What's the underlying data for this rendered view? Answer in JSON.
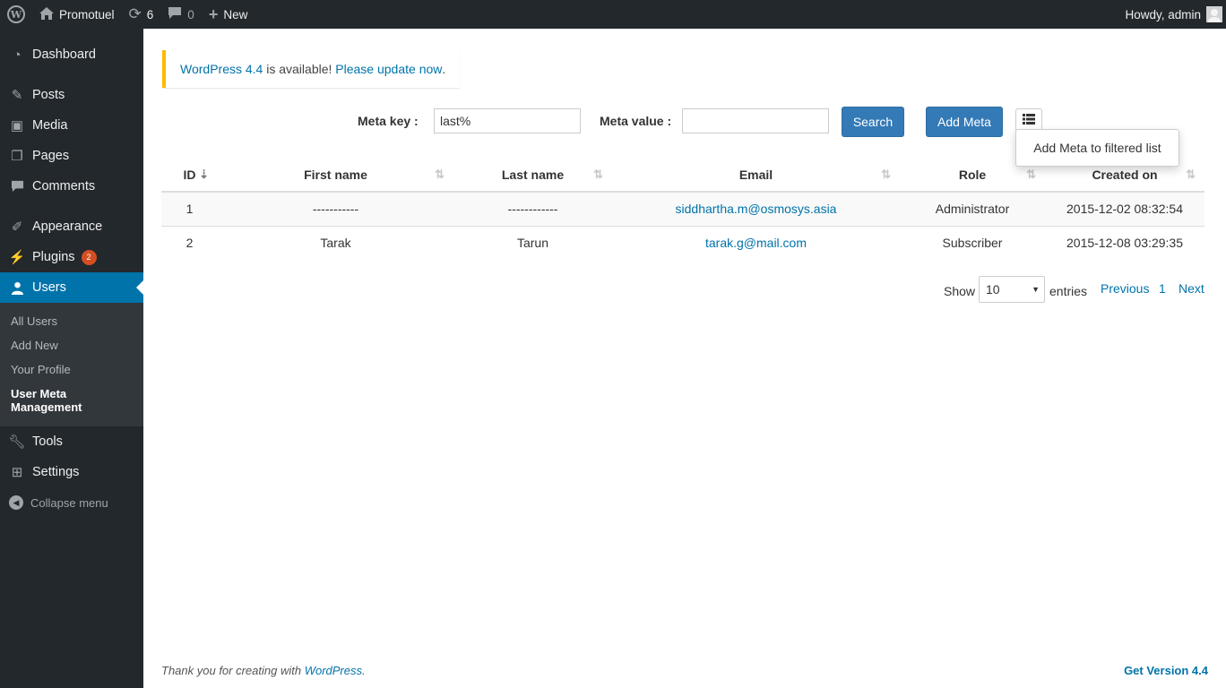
{
  "adminbar": {
    "site_name": "Promotuel",
    "updates_count": "6",
    "comments_count": "0",
    "new_label": "New",
    "greeting": "Howdy, admin"
  },
  "sidebar": {
    "items": [
      {
        "label": "Dashboard",
        "icon": "dashboard-icon"
      },
      {
        "label": "Posts",
        "icon": "pin-icon"
      },
      {
        "label": "Media",
        "icon": "media-icon"
      },
      {
        "label": "Pages",
        "icon": "pages-icon"
      },
      {
        "label": "Comments",
        "icon": "comments-icon"
      },
      {
        "label": "Appearance",
        "icon": "brush-icon"
      },
      {
        "label": "Plugins",
        "icon": "plug-icon",
        "badge": "2"
      },
      {
        "label": "Users",
        "icon": "user-icon"
      },
      {
        "label": "Tools",
        "icon": "wrench-icon"
      },
      {
        "label": "Settings",
        "icon": "settings-icon"
      }
    ],
    "users_submenu": [
      "All Users",
      "Add New",
      "Your Profile",
      "User Meta Management"
    ],
    "collapse_label": "Collapse menu"
  },
  "notice": {
    "link1": "WordPress 4.4",
    "middle": " is available! ",
    "link2": "Please update now",
    "end": "."
  },
  "filters": {
    "meta_key_label": "Meta key :",
    "meta_key_value": "last%",
    "meta_value_label": "Meta value :",
    "meta_value_value": "",
    "search_label": "Search",
    "add_meta_label": "Add Meta",
    "dropdown_item": "Add Meta to filtered list"
  },
  "table": {
    "headers": [
      "ID",
      "First name",
      "Last name",
      "Email",
      "Role",
      "Created on"
    ],
    "rows": [
      {
        "id": "1",
        "first": "-----------",
        "last": "------------",
        "email": "siddhartha.m@osmosys.asia",
        "role": "Administrator",
        "created": "2015-12-02 08:32:54"
      },
      {
        "id": "2",
        "first": "Tarak",
        "last": "Tarun",
        "email": "tarak.g@mail.com",
        "role": "Subscriber",
        "created": "2015-12-08 03:29:35"
      }
    ]
  },
  "pagination": {
    "show_label": "Show",
    "page_size": "10",
    "entries_label": "entries",
    "previous": "Previous",
    "page": "1",
    "next": "Next"
  },
  "footer": {
    "thanks_prefix": "Thank you for creating with ",
    "thanks_link": "WordPress",
    "thanks_suffix": ".",
    "version": "Get Version 4.4"
  },
  "colors": {
    "adminbar_bg": "#23282d",
    "accent": "#0073aa",
    "button": "#337ab7",
    "notice_border": "#ffb900",
    "badge": "#d54e21"
  }
}
